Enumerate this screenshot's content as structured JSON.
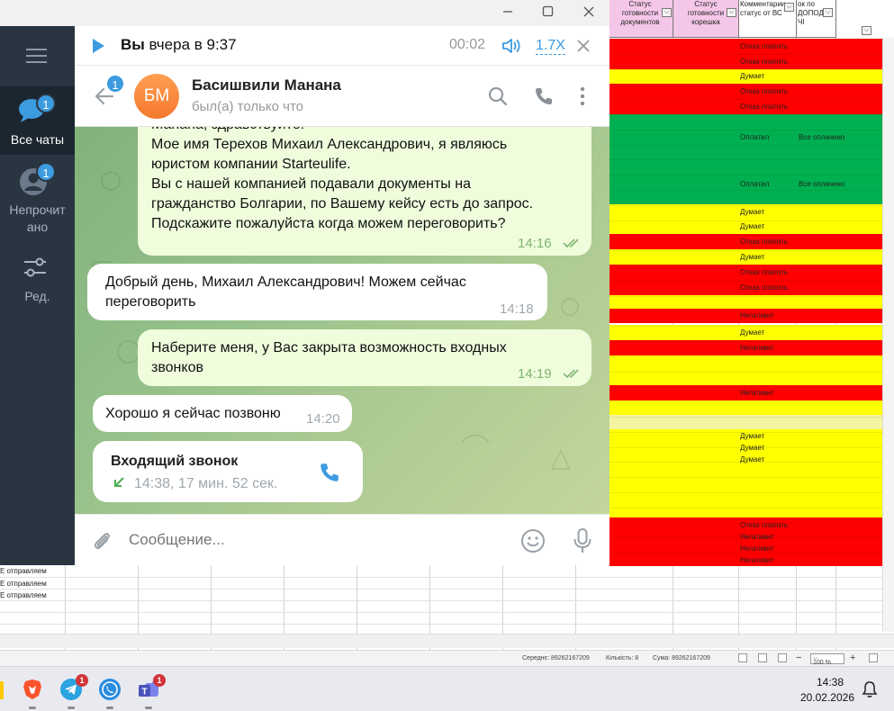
{
  "spreadsheet": {
    "headers": {
      "docs_status": "Статус готовности документов",
      "spine_status": "Статус готовности корешка",
      "comment": "Комментарии статус от ВС",
      "extra": "ок по ДОПОДА ЧІ"
    },
    "rows": [
      {
        "comment": "Отказ платить",
        "extra": "",
        "color": "#ff0000"
      },
      {
        "comment": "Отказ платить",
        "extra": "",
        "color": "#ff0000"
      },
      {
        "comment": "Думает",
        "extra": "",
        "color": "#ffff00"
      },
      {
        "comment": "Отказ платить",
        "extra": "",
        "color": "#ff0000"
      },
      {
        "comment": "Отказ платить",
        "extra": "",
        "color": "#ff0000"
      },
      {
        "comment": "Оплатил",
        "extra": "Все оплачено",
        "color": "#00b050"
      },
      {
        "comment": "Оплатил",
        "extra": "Все оплачено",
        "color": "#00b050"
      },
      {
        "comment": "Думает",
        "extra": "",
        "color": "#ffff00"
      },
      {
        "comment": "Думает",
        "extra": "",
        "color": "#ffff00"
      },
      {
        "comment": "Отказ платить",
        "extra": "",
        "color": "#ff0000"
      },
      {
        "comment": "Думает",
        "extra": "",
        "color": "#ffff00"
      },
      {
        "comment": "Отказ платить",
        "extra": "",
        "color": "#ff0000"
      },
      {
        "comment": "Отказ платить",
        "extra": "",
        "color": "#ff0000"
      },
      {
        "comment": "Негативит",
        "extra": "",
        "color": "#ff0000"
      },
      {
        "comment": "Думает",
        "extra": "",
        "color": "#ffff00"
      },
      {
        "comment": "Негативит",
        "extra": "",
        "color": "#ff0000"
      },
      {
        "comment": "Негативит",
        "extra": "",
        "color": "#ff0000"
      },
      {
        "comment": "Думает",
        "extra": "",
        "color": "#ffff00"
      },
      {
        "comment": "Думает",
        "extra": "",
        "color": "#ffff00"
      },
      {
        "comment": "Думает",
        "extra": "",
        "color": "#ffff00"
      },
      {
        "comment": "Отказ платить",
        "extra": "",
        "color": "#ff0000"
      },
      {
        "comment": "Негативит",
        "extra": "",
        "color": "#ff0000"
      },
      {
        "comment": "Негативит",
        "extra": "",
        "color": "#ff0000"
      },
      {
        "comment": "Негативит",
        "extra": "",
        "color": "#ff0000"
      }
    ],
    "left_rows": [
      "Е отправляем",
      "Е отправляем",
      "Е отправляем"
    ],
    "status_bar": {
      "average": "Середнє: 89262167209",
      "count": "Кількість: 8",
      "sum": "Сума: 89262167209",
      "zoom": "100 %"
    }
  },
  "telegram": {
    "sidebar": {
      "all_chats": {
        "label": "Все чаты",
        "badge": "1"
      },
      "unread": {
        "label_line1": "Непрочит",
        "label_line2": "ано",
        "badge": "1"
      },
      "edit": {
        "label": "Ред."
      }
    },
    "player": {
      "author": "Вы",
      "when": "вчера в 9:37",
      "position": "00:02",
      "speed": "1.7X"
    },
    "chat_header": {
      "back_badge": "1",
      "avatar_initials": "БМ",
      "name": "Басишвили Манана",
      "status": "был(а) только что"
    },
    "messages": [
      {
        "direction": "out",
        "lines": [
          "Манана, здравствуйте!",
          "Мое имя Терехов Михаил Александрович, я являюсь",
          "юристом компании Starteulife.",
          "Вы с нашей компанией подавали документы на",
          "гражданство Болгарии, по Вашему кейсу есть до запрос.",
          "Подскажите пожалуйста когда можем переговорить?"
        ],
        "time": "14:16"
      },
      {
        "direction": "in",
        "lines": [
          "Добрый день, Михаил Александрович! Можем сейчас",
          "переговорить"
        ],
        "time": "14:18"
      },
      {
        "direction": "out",
        "lines": [
          "Наберите меня, у Вас закрыта возможность входных",
          "звонков"
        ],
        "time": "14:19"
      },
      {
        "direction": "in",
        "lines": [
          "Хорошо я сейчас позвоню"
        ],
        "time": "14:20"
      }
    ],
    "call": {
      "title": "Входящий звонок",
      "details": "14:38, 17 мин. 52 сек."
    },
    "input_placeholder": "Сообщение...",
    "accent_color": "#3d9be0"
  },
  "taskbar": {
    "time": "14:38",
    "date": "20.02.2026",
    "apps": [
      {
        "name": "brave",
        "badge": ""
      },
      {
        "name": "telegram",
        "badge": "1"
      },
      {
        "name": "viber",
        "badge": ""
      },
      {
        "name": "teams",
        "badge": "1"
      }
    ]
  }
}
